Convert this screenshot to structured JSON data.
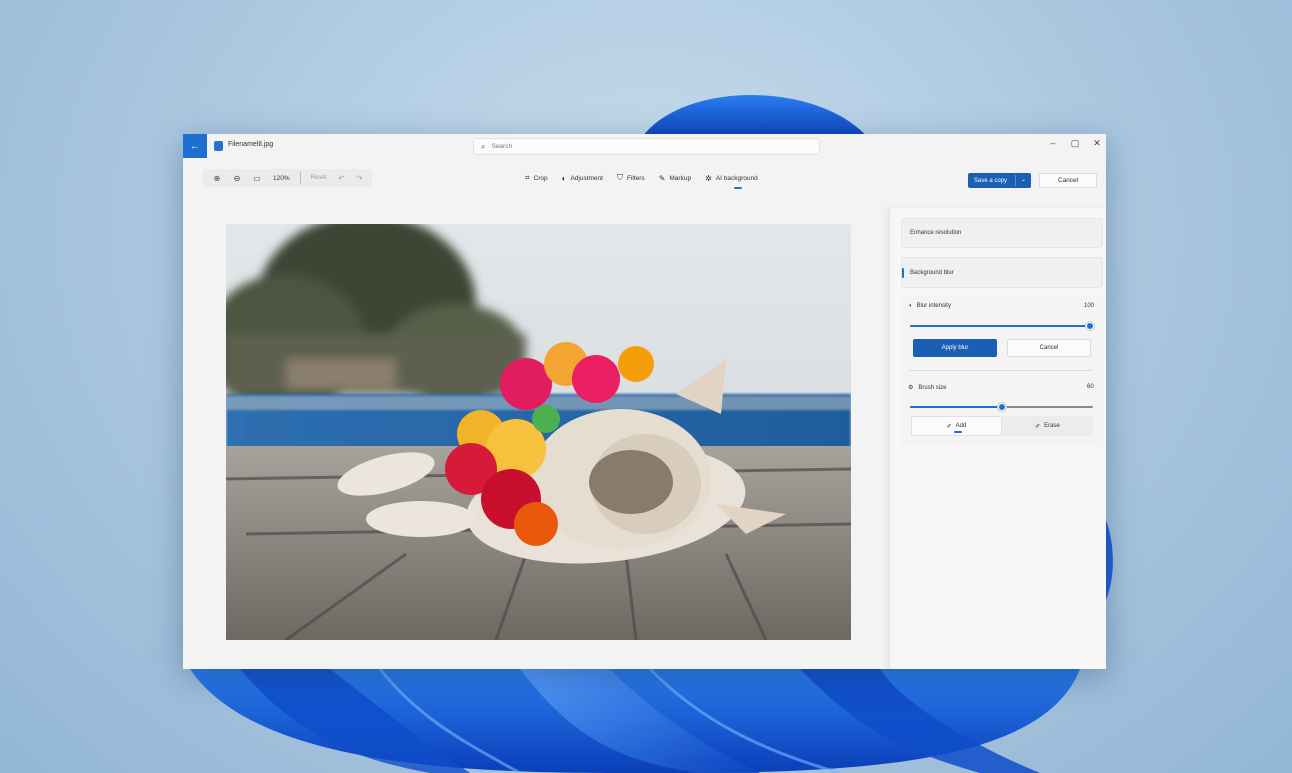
{
  "window": {
    "file_name": "Filenameltl.jpg",
    "search_placeholder": "Search"
  },
  "zoom": {
    "level": "120%",
    "reset_label": "Reset"
  },
  "tools": [
    {
      "label": "Crop",
      "icon": "crop-icon"
    },
    {
      "label": "Adjustment",
      "icon": "adjustment-icon"
    },
    {
      "label": "Filters",
      "icon": "filters-icon"
    },
    {
      "label": "Markup",
      "icon": "markup-icon"
    },
    {
      "label": "AI background",
      "icon": "ai-background-icon",
      "active": true
    }
  ],
  "actions": {
    "save_label": "Save a copy",
    "cancel_label": "Cancel"
  },
  "panel": {
    "enhance_label": "Enhance resolution",
    "background_blur_label": "Background blur",
    "blur_intensity_label": "Blur intensity",
    "blur_intensity_value": "100",
    "blur_intensity_fraction": 1.0,
    "apply_label": "Apply blur",
    "cancel_label": "Cancel",
    "brush_size_label": "Brush size",
    "brush_size_value": "60",
    "brush_size_fraction": 0.5,
    "add_label": "Add",
    "erase_label": "Erase"
  },
  "colors": {
    "accent": "#1a5fb4",
    "window_bg": "#f3f3f3"
  }
}
